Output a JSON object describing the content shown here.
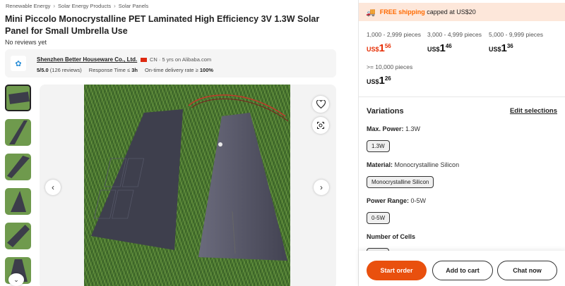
{
  "breadcrumb": [
    "Renewable Energy",
    "Solar Energy Products",
    "Solar Panels"
  ],
  "product": {
    "title": "Mini Piccolo Monocrystalline PET Laminated High Efficiency 3V 1.3W Solar Panel for Small Umbrella Use",
    "reviews": "No reviews yet"
  },
  "supplier": {
    "name": "Shenzhen Better Houseware Co., Ltd.",
    "country": "CN · 5 yrs on Alibaba.com",
    "rating": "5/5.0",
    "rating_count": "(126 reviews)",
    "response_label": "Response Time ≤",
    "response_value": "3h",
    "delivery_label": "On-time delivery rate ≥",
    "delivery_value": "100%"
  },
  "shipping": {
    "free": "FREE shipping",
    "cap": "capped at US$20"
  },
  "tiers": [
    {
      "range": "1,000 - 2,999 pieces",
      "cur": "US$",
      "whole": "1",
      "cents": "56"
    },
    {
      "range": "3,000 - 4,999 pieces",
      "cur": "US$",
      "whole": "1",
      "cents": "46"
    },
    {
      "range": "5,000 - 9,999 pieces",
      "cur": "US$",
      "whole": "1",
      "cents": "36"
    },
    {
      "range": ">= 10,000 pieces",
      "cur": "US$",
      "whole": "1",
      "cents": "26"
    }
  ],
  "variations": {
    "title": "Variations",
    "edit": "Edit selections",
    "attrs": [
      {
        "label": "Max. Power:",
        "value": "1.3W",
        "chip": "1.3W"
      },
      {
        "label": "Material:",
        "value": "Monocrystalline Silicon",
        "chip": "Monocrystalline Silicon"
      },
      {
        "label": "Power Range:",
        "value": "0-5W",
        "chip": "0-5W"
      },
      {
        "label": "Number of Cells",
        "value": "",
        "chip": ""
      }
    ]
  },
  "actions": {
    "start_order": "Start order",
    "add_to_cart": "Add to cart",
    "chat_now": "Chat now"
  },
  "colors": {
    "accent": "#e9500e",
    "price_red": "#e62e04",
    "shipping_bg": "#fde7da"
  }
}
